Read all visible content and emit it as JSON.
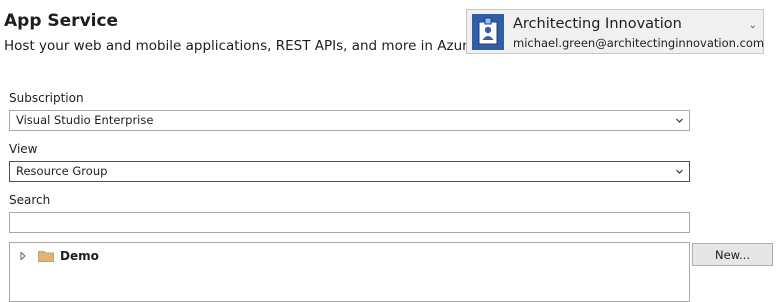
{
  "header": {
    "title": "App Service",
    "subtitle": "Host your web and mobile applications, REST APIs, and more in Azure"
  },
  "account": {
    "name": "Architecting Innovation",
    "email": "michael.green@architectinginnovation.com",
    "chevron": "⌄",
    "avatar_icon": "user-badge-icon"
  },
  "subscription": {
    "label": "Subscription",
    "value": "Visual Studio Enterprise"
  },
  "view": {
    "label": "View",
    "value": "Resource Group"
  },
  "search": {
    "label": "Search",
    "value": ""
  },
  "tree": {
    "items": [
      {
        "label": "Demo",
        "icon": "folder-icon",
        "expanded": false
      }
    ]
  },
  "actions": {
    "new_label": "New..."
  },
  "colors": {
    "focus_border": "#1c5aa8",
    "folder": "#dcb67a",
    "avatar_background": "#2e5fa8"
  }
}
